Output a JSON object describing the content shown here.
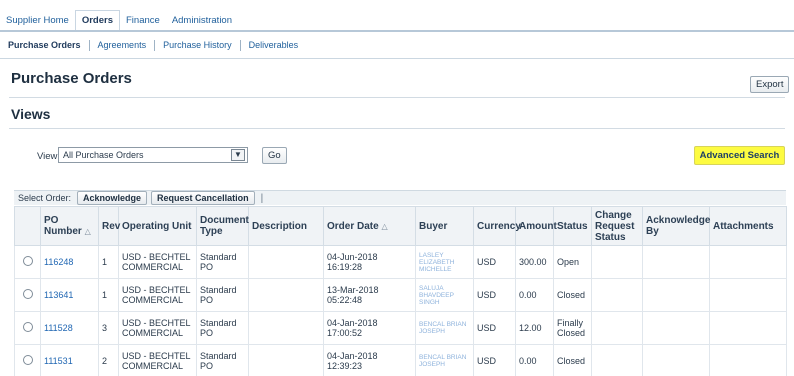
{
  "tabs": [
    {
      "label": "Supplier Home",
      "active": false
    },
    {
      "label": "Orders",
      "active": true
    },
    {
      "label": "Finance",
      "active": false
    },
    {
      "label": "Administration",
      "active": false
    }
  ],
  "subtabs": [
    "Purchase Orders",
    "Agreements",
    "Purchase History",
    "Deliverables"
  ],
  "page": {
    "title": "Purchase Orders",
    "export_label": "Export"
  },
  "views": {
    "title": "Views",
    "view_label": "View",
    "selected_view": "All Purchase Orders",
    "go_label": "Go",
    "advanced_search_label": "Advanced Search"
  },
  "selection": {
    "label": "Select Order:",
    "acknowledge_label": "Acknowledge",
    "request_cancellation_label": "Request Cancellation",
    "separator": "|"
  },
  "table": {
    "columns": {
      "po_number": "PO Number",
      "rev": "Rev",
      "operating_unit": "Operating Unit",
      "document_type": "Document Type",
      "description": "Description",
      "order_date": "Order Date",
      "buyer": "Buyer",
      "currency": "Currency",
      "amount": "Amount",
      "status": "Status",
      "change_request_status": "Change Request Status",
      "acknowledge_by": "Acknowledge By",
      "attachments": "Attachments"
    },
    "sort_glyph": "△",
    "rows": [
      {
        "po": "116248",
        "rev": "1",
        "ou": "USD - BECHTEL COMMERCIAL",
        "doc_type": "Standard PO",
        "description": "",
        "order_date": "04-Jun-2018 16:19:28",
        "buyer": "LASLEY ELIZABETH MICHELLE",
        "currency": "USD",
        "amount": "300.00",
        "status": "Open"
      },
      {
        "po": "113641",
        "rev": "1",
        "ou": "USD - BECHTEL COMMERCIAL",
        "doc_type": "Standard PO",
        "description": "",
        "order_date": "13-Mar-2018 05:22:48",
        "buyer": "SALUJA BHAVDEEP SINGH",
        "currency": "USD",
        "amount": "0.00",
        "status": "Closed"
      },
      {
        "po": "111528",
        "rev": "3",
        "ou": "USD - BECHTEL COMMERCIAL",
        "doc_type": "Standard PO",
        "description": "",
        "order_date": "04-Jan-2018 17:00:52",
        "buyer": "BENCAL BRIAN JOSEPH",
        "currency": "USD",
        "amount": "12.00",
        "status": "Finally Closed"
      },
      {
        "po": "111531",
        "rev": "2",
        "ou": "USD - BECHTEL COMMERCIAL",
        "doc_type": "Standard PO",
        "description": "",
        "order_date": "04-Jan-2018 12:39:23",
        "buyer": "BENCAL BRIAN JOSEPH",
        "currency": "USD",
        "amount": "0.00",
        "status": "Closed"
      }
    ]
  },
  "colors": {
    "accent_button": "#fdfb41",
    "link": "#2167b3",
    "header_bg": "#f0f3f6"
  }
}
